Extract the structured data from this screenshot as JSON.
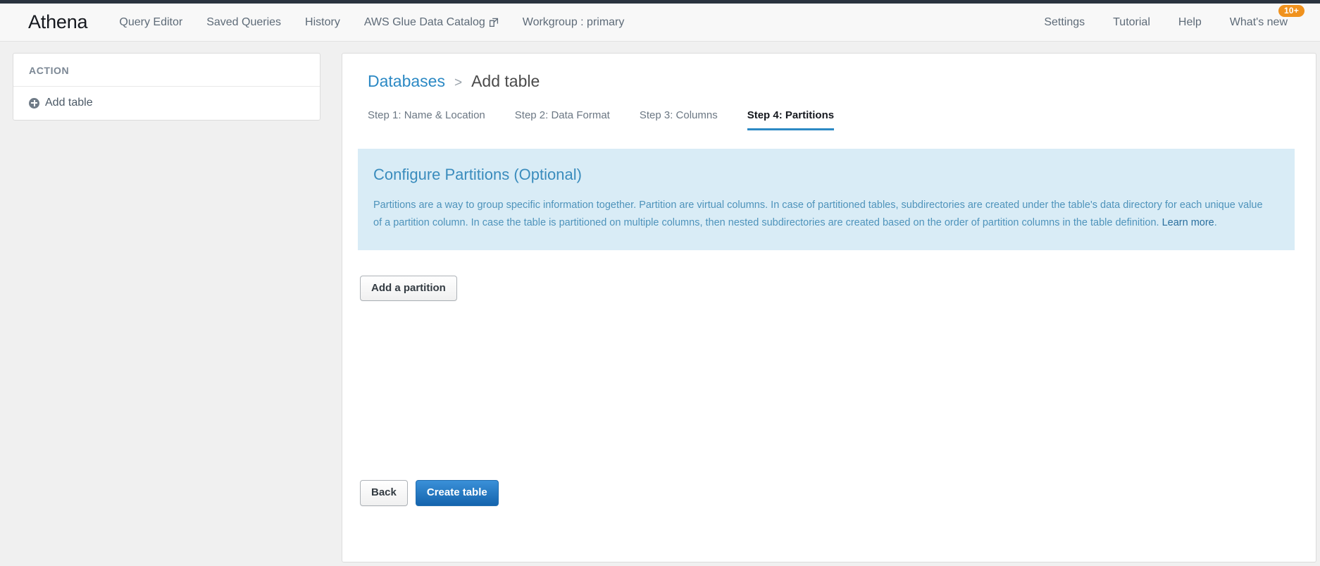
{
  "header": {
    "brand": "Athena",
    "nav_left": [
      {
        "label": "Query Editor",
        "icon": null
      },
      {
        "label": "Saved Queries",
        "icon": null
      },
      {
        "label": "History",
        "icon": null
      },
      {
        "label": "AWS Glue Data Catalog",
        "icon": "external-link-icon"
      },
      {
        "label": "Workgroup : primary",
        "icon": null
      }
    ],
    "nav_right": [
      {
        "label": "Settings"
      },
      {
        "label": "Tutorial"
      },
      {
        "label": "Help"
      },
      {
        "label": "What's new"
      }
    ],
    "badge": "10+",
    "badge_color": "#f0921e"
  },
  "sidebar": {
    "title": "ACTION",
    "items": [
      {
        "label": "Add table",
        "icon": "plus-circle-icon"
      }
    ]
  },
  "breadcrumb": {
    "root": "Databases",
    "separator": ">",
    "current": "Add table"
  },
  "tabs": [
    {
      "label": "Step 1: Name & Location",
      "active": false
    },
    {
      "label": "Step 2: Data Format",
      "active": false
    },
    {
      "label": "Step 3: Columns",
      "active": false
    },
    {
      "label": "Step 4: Partitions",
      "active": true
    }
  ],
  "info_panel": {
    "title": "Configure Partitions (Optional)",
    "body": "Partitions are a way to group specific information together. Partition are virtual columns. In case of partitioned tables, subdirectories are created under the table's data directory for each unique value of a partition column. In case the table is partitioned on multiple columns, then nested subdirectories are created based on the order of partition columns in the table definition.",
    "link_label": "Learn more",
    "link_suffix": ".",
    "background": "#d9ecf6",
    "text_color": "#4e93bb"
  },
  "actions": {
    "add_partition": "Add a partition",
    "back": "Back",
    "create_table": "Create table",
    "primary_color": "#1464ad"
  }
}
